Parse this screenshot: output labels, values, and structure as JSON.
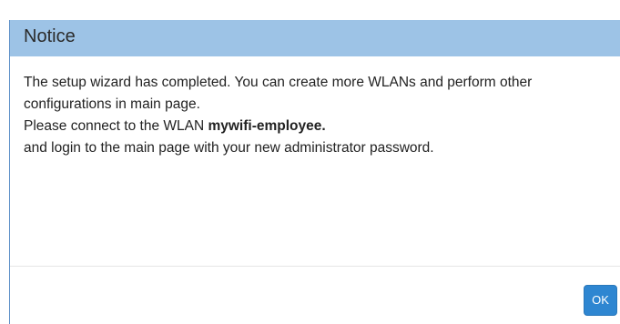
{
  "dialog": {
    "title": "Notice",
    "message": {
      "line1": "The setup wizard has completed. You can create more WLANs and perform other configurations in main page.",
      "line2_prefix": "Please connect to the WLAN ",
      "ssid": "mywifi-employee.",
      "line3": "and login to the main page with your new administrator password."
    },
    "ok_label": "OK"
  },
  "colors": {
    "header_bg": "#9dc3e6",
    "button_bg": "#2e86d1",
    "border": "#5b8fc7"
  }
}
